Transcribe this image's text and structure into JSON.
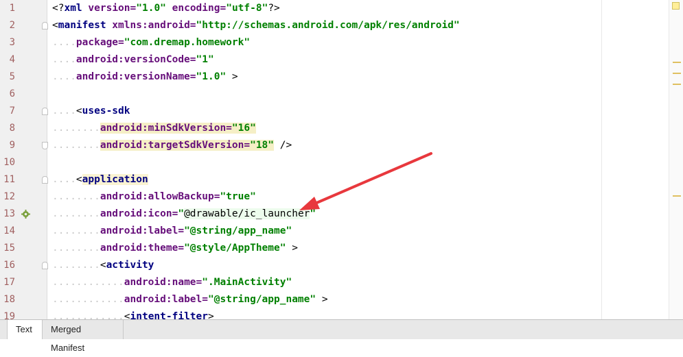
{
  "editor": {
    "line_numbers": [
      "1",
      "2",
      "3",
      "4",
      "5",
      "6",
      "7",
      "8",
      "9",
      "10",
      "11",
      "12",
      "13",
      "14",
      "15",
      "16",
      "17",
      "18",
      "19"
    ],
    "lines": {
      "l1": {
        "a": "<?",
        "b": "xml",
        "c": " version=",
        "d": "\"1.0\"",
        "e": " encoding=",
        "f": "\"utf-8\"",
        "g": "?>"
      },
      "l2": {
        "a": "<",
        "b": "manifest",
        "c": " xmlns:android=",
        "d": "\"http://schemas.android.com/apk/res/android\""
      },
      "l3": {
        "dots": "....",
        "attr": "package=",
        "val": "\"com.dremap.homework\""
      },
      "l4": {
        "dots": "....",
        "attr": "android:versionCode=",
        "val": "\"1\""
      },
      "l5": {
        "dots": "....",
        "attr": "android:versionName=",
        "val": "\"1.0\"",
        "end": " >"
      },
      "l7": {
        "dots": "....",
        "open": "<",
        "tag": "uses-sdk"
      },
      "l8": {
        "dots": "........",
        "attr": "android:minSdkVersion=",
        "val": "\"16\""
      },
      "l9": {
        "dots": "........",
        "attr": "android:targetSdkVersion=",
        "val": "\"18\"",
        "end": " />"
      },
      "l11": {
        "dots": "....",
        "open": "<",
        "tag": "application"
      },
      "l12": {
        "dots": "........",
        "attr": "android:allowBackup=",
        "val": "\"true\""
      },
      "l13": {
        "dots": "........",
        "attr": "android:icon=",
        "q1": "\"",
        "plain": "@drawable/ic_launcher",
        "q2": "\""
      },
      "l14": {
        "dots": "........",
        "attr": "android:label=",
        "val": "\"@string/app_name\""
      },
      "l15": {
        "dots": "........",
        "attr": "android:theme=",
        "val": "\"@style/AppTheme\"",
        "end": " >"
      },
      "l16": {
        "dots": "........",
        "open": "<",
        "tag": "activity"
      },
      "l17": {
        "dots": "............",
        "attr": "android:name=",
        "val": "\".MainActivity\""
      },
      "l18": {
        "dots": "............",
        "attr": "android:label=",
        "val": "\"@string/app_name\"",
        "end": " >"
      },
      "l19": {
        "dots": "............",
        "open": "<",
        "tag": "intent-filter",
        "end": ">"
      }
    }
  },
  "tabs": [
    {
      "label": "Text",
      "active": true
    },
    {
      "label": "Merged Manifest",
      "active": false
    }
  ],
  "colors": {
    "tag": "#000080",
    "attribute": "#660e7a",
    "value": "#008000",
    "arrow": "#e8383d"
  }
}
